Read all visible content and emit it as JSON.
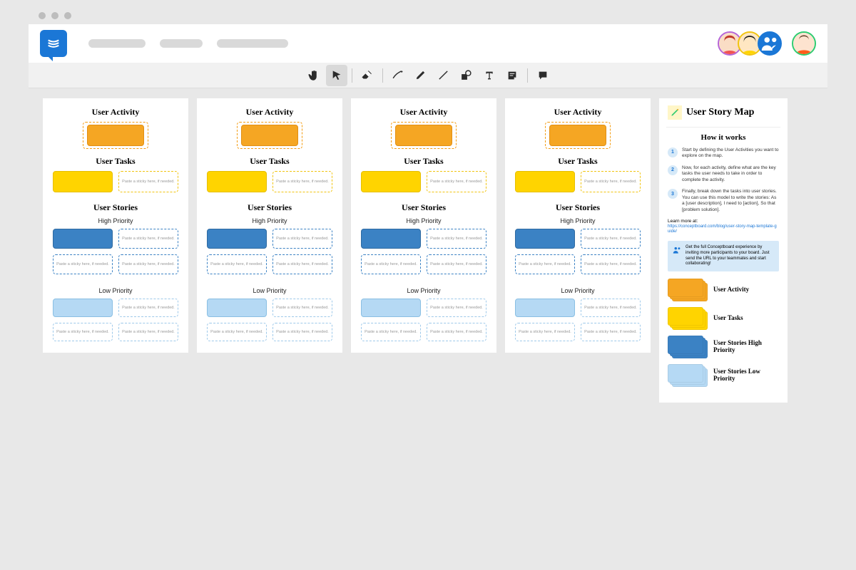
{
  "column": {
    "activity_h": "User Activity",
    "tasks_h": "User Tasks",
    "stories_h": "User Stories",
    "high": "High Priority",
    "low": "Low Priority",
    "placeholder": "Paste a sticky here, if needed."
  },
  "side": {
    "title": "User Story Map",
    "how": "How it works",
    "steps": [
      "Start by defining the User Activities you want to explore on the map.",
      "Now, for each activity, define what are the key tasks the user needs to take in order to complete the activity.",
      "Finally, break down the tasks into user stories. You can use this model to write the stories: As a [user description], I need to [action], So that [problem solution]."
    ],
    "learn": "Learn more at:",
    "learn_url": "https://conceptboard.com/blog/user-story-map-template-guide/",
    "tip": "Get the full Conceptboard experience by inviting more participants to your board. Just send the URL to your teammates and start collaborating!",
    "legend": {
      "activity": "User Activity",
      "tasks": "User Tasks",
      "high": "User Stories High Priority",
      "low": "User Stories Low Priority"
    }
  },
  "colors": {
    "orange": "#f5a623",
    "yellow": "#ffd400",
    "blue": "#3b82c4",
    "lblue": "#b5d9f4"
  }
}
